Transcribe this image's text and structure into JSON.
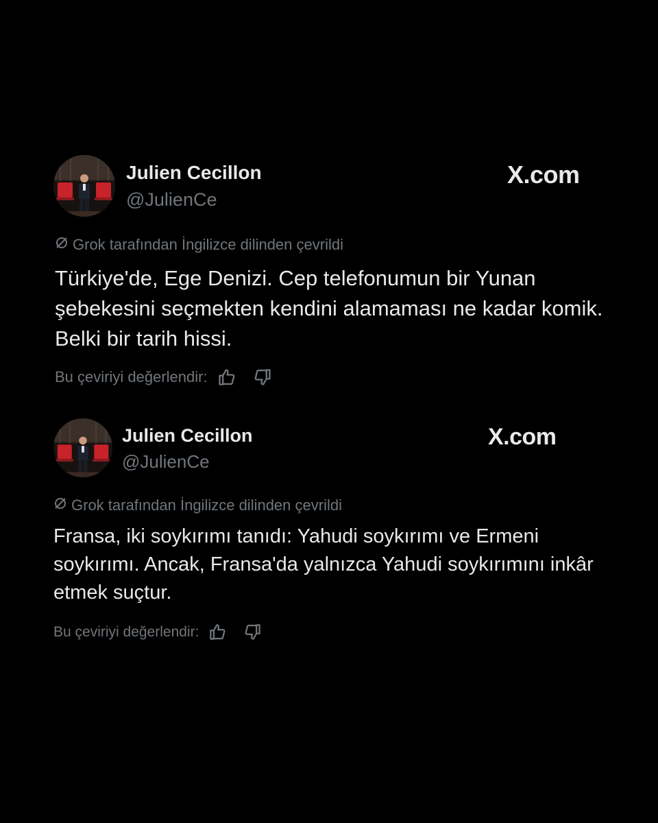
{
  "colors": {
    "background": "#000000",
    "primary_text": "#e7e9ea",
    "secondary_text": "#71767b"
  },
  "tweets": [
    {
      "author": {
        "name": "Julien Cecillon",
        "handle": "@JulienCe",
        "avatar": "avatar-photo"
      },
      "brand": "X.com",
      "translation_note": "Grok tarafından İngilizce dilinden çevrildi",
      "text": "Türkiye'de, Ege Denizi. Cep telefonumun bir Yunan şebekesini seçmekten kendini alamaması ne kadar komik. Belki bir tarih hissi.",
      "rate_label": "Bu çeviriyi değerlendir:",
      "icons": [
        "translate-icon",
        "thumbs-up-icon",
        "thumbs-down-icon"
      ]
    },
    {
      "author": {
        "name": "Julien Cecillon",
        "handle": "@JulienCe",
        "avatar": "avatar-photo"
      },
      "brand": "X.com",
      "translation_note": "Grok tarafından İngilizce dilinden çevrildi",
      "text": "Fransa, iki soykırımı tanıdı: Yahudi soykırımı ve Ermeni soykırımı. Ancak, Fransa'da yalnızca Yahudi soykırımını inkâr etmek suçtur.",
      "rate_label": "Bu çeviriyi değerlendir:",
      "icons": [
        "translate-icon",
        "thumbs-up-icon",
        "thumbs-down-icon"
      ]
    }
  ]
}
